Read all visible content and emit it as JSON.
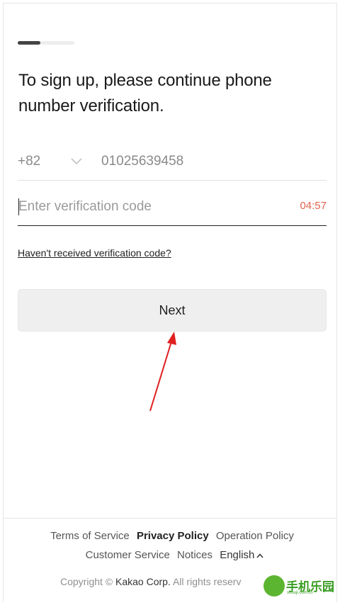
{
  "signup": {
    "progress_fraction": 0.4,
    "heading": "To sign up, please continue phone number verification.",
    "phone": {
      "country_code": "+82",
      "number": "01025639458"
    },
    "verification": {
      "placeholder": "Enter verification code",
      "value": "",
      "timer": "04:57"
    },
    "resend_link": "Haven't received verification code?",
    "next_label": "Next"
  },
  "footer": {
    "links_row1": [
      "Terms of Service",
      "Privacy Policy",
      "Operation Policy"
    ],
    "links_row2": [
      "Customer Service",
      "Notices",
      "English"
    ],
    "copyright_prefix": "Copyright ©",
    "company": "Kakao Corp.",
    "copyright_suffix": "All rights reserv"
  },
  "watermark": {
    "text": "手机乐园",
    "sub": "shouji.com.cn"
  },
  "colors": {
    "timer": "#e0634d",
    "button_bg": "#efefef",
    "annotation_arrow": "#e02020"
  },
  "icons": {
    "dropdown": "chevron-down-icon",
    "language": "caret-up-icon"
  }
}
